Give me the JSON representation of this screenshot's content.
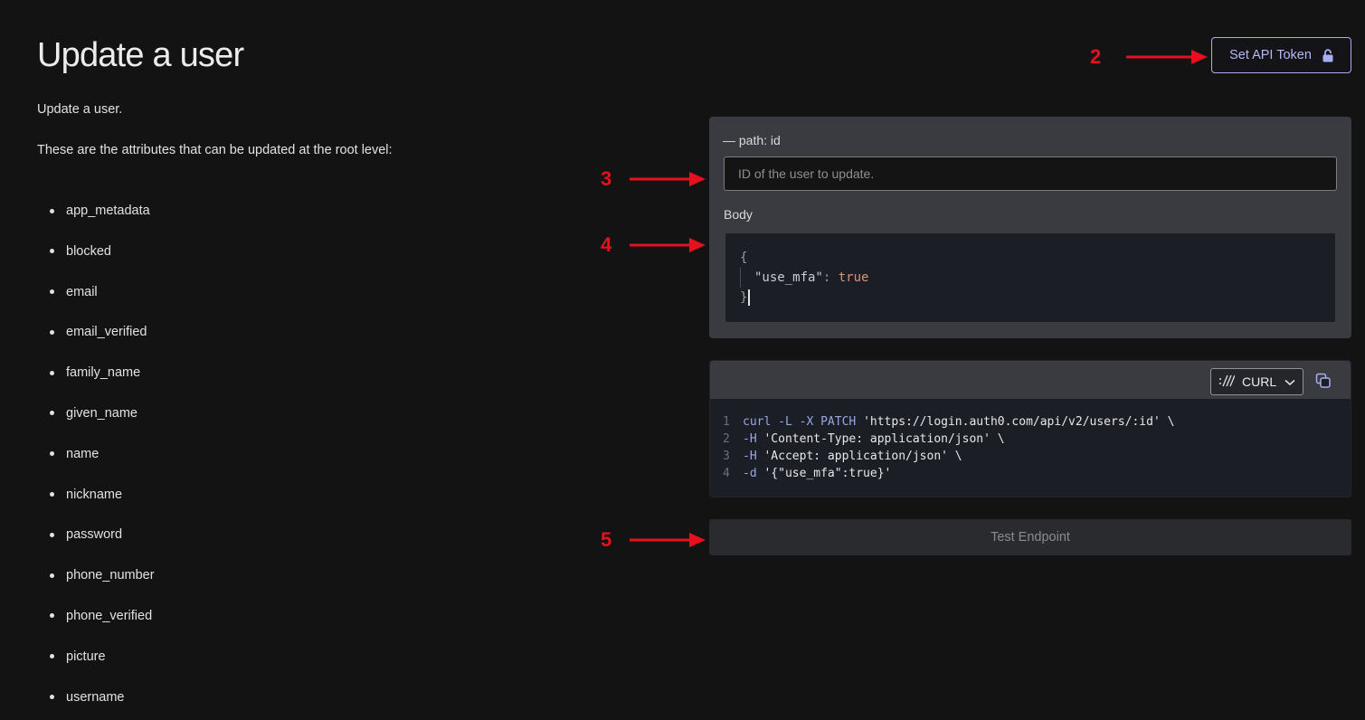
{
  "page": {
    "title": "Update a user",
    "intro": "Update a user.",
    "attributes_heading": "These are the attributes that can be updated at the root level:",
    "attributes": [
      "app_metadata",
      "blocked",
      "email",
      "email_verified",
      "family_name",
      "given_name",
      "name",
      "nickname",
      "password",
      "phone_number",
      "phone_verified",
      "picture",
      "username"
    ]
  },
  "token_button": {
    "label": "Set API Token",
    "icon": "lock-icon"
  },
  "annotations": {
    "a2": "2",
    "a3": "3",
    "a4": "4",
    "a5": "5",
    "arrow_color": "#e8101e"
  },
  "params": {
    "path_label": "— path: id",
    "id_placeholder": "ID of the user to update.",
    "id_value": "",
    "body_label": "Body",
    "body": {
      "open": "{",
      "key": "\"use_mfa\"",
      "colon": ": ",
      "value": "true",
      "close": "}"
    }
  },
  "code_sample": {
    "language": "CURL",
    "language_icon": "curl-slashes-icon",
    "copy_icon": "copy-icon",
    "lines": [
      {
        "n": "1",
        "parts": [
          {
            "c": "tok-cmd",
            "t": "curl "
          },
          {
            "c": "tok-flag",
            "t": "-L -X PATCH "
          },
          {
            "c": "tok-str",
            "t": "'https://login.auth0.com/api/v2/users/:id' \\"
          }
        ]
      },
      {
        "n": "2",
        "parts": [
          {
            "c": "tok-flag",
            "t": "-H "
          },
          {
            "c": "tok-str",
            "t": "'Content-Type: application/json' \\"
          }
        ]
      },
      {
        "n": "3",
        "parts": [
          {
            "c": "tok-flag",
            "t": "-H "
          },
          {
            "c": "tok-str",
            "t": "'Accept: application/json' \\"
          }
        ]
      },
      {
        "n": "4",
        "parts": [
          {
            "c": "tok-flag",
            "t": "-d "
          },
          {
            "c": "tok-str",
            "t": "'{\"use_mfa\":true}'"
          }
        ]
      }
    ]
  },
  "test_button": {
    "label": "Test Endpoint"
  },
  "colors": {
    "background": "#131314",
    "panel": "#393b40",
    "editor": "#1b1e25",
    "accent": "#b3b8f5",
    "json_value": "#e0906d"
  }
}
